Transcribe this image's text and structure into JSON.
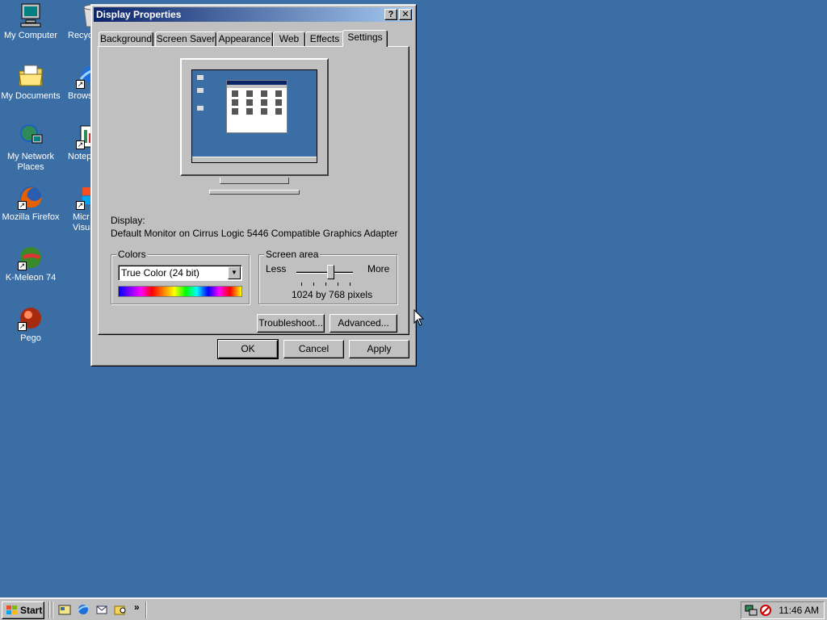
{
  "desktop": {
    "icons": [
      {
        "label": "My Computer",
        "icon": "my-computer-icon"
      },
      {
        "label": "Recyc",
        "icon": "recycle-bin-icon"
      },
      {
        "label": "My Documents",
        "icon": "my-documents-icon"
      },
      {
        "label": "Brows",
        "icon": "browser-icon"
      },
      {
        "label": "My Network Places",
        "icon": "network-places-icon"
      },
      {
        "label": "Notep",
        "icon": "notepad-icon"
      },
      {
        "label": "Mozilla Firefox",
        "icon": "firefox-icon"
      },
      {
        "label": "Micr Visua",
        "icon": "visual-studio-icon"
      },
      {
        "label": "K-Meleon 74",
        "icon": "k-meleon-icon"
      },
      {
        "label": "Pego",
        "icon": "pego-icon"
      }
    ]
  },
  "window": {
    "title": "Display Properties",
    "help_glyph": "?",
    "close_glyph": "✕",
    "tabs": [
      "Background",
      "Screen Saver",
      "Appearance",
      "Web",
      "Effects",
      "Settings"
    ],
    "active_tab": "Settings",
    "display_label": "Display:",
    "display_value": "Default Monitor on Cirrus Logic 5446 Compatible Graphics Adapter",
    "colors": {
      "title": "Colors",
      "selected": "True Color (24 bit)",
      "arrow": "▼"
    },
    "screen_area": {
      "title": "Screen area",
      "less": "Less",
      "more": "More",
      "value": "1024 by 768 pixels",
      "slider_position": 0.6
    },
    "buttons": {
      "troubleshoot": "Troubleshoot...",
      "advanced": "Advanced...",
      "ok": "OK",
      "cancel": "Cancel",
      "apply": "Apply"
    }
  },
  "taskbar": {
    "start": "Start",
    "more_glyph": "»",
    "clock": "11:46 AM"
  },
  "colors": {
    "desktop": "#3a6ea5",
    "titlebar": "#0a246a",
    "face": "#c0c0c0"
  }
}
